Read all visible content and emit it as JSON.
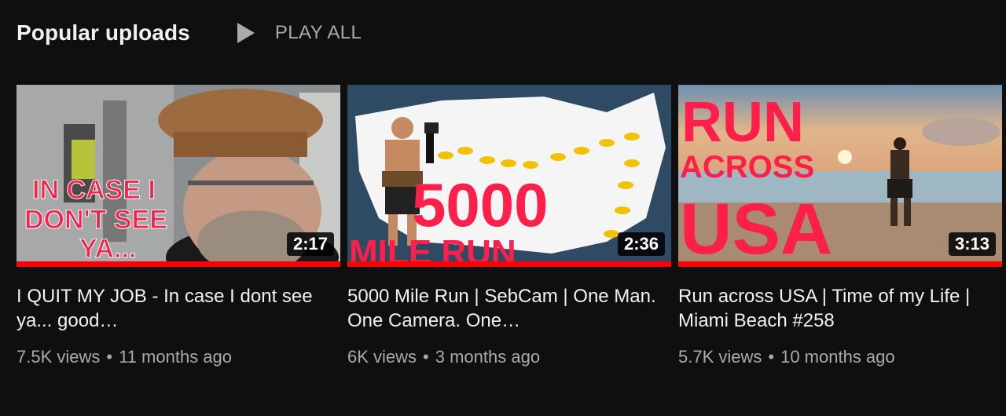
{
  "section": {
    "title": "Popular uploads",
    "play_all_label": "PLAY ALL"
  },
  "videos": [
    {
      "title": "I QUIT MY JOB - In case I dont see ya... good…",
      "duration": "2:17",
      "views": "7.5K views",
      "age": "11 months ago",
      "thumb_text": [
        "IN CASE I",
        "DON'T SEE",
        "YA..."
      ]
    },
    {
      "title": "5000 Mile Run | SebCam | One Man. One Camera. One…",
      "duration": "2:36",
      "views": "6K views",
      "age": "3 months ago",
      "thumb_text": [
        "5000",
        "MILE RUN"
      ]
    },
    {
      "title": "Run across USA | Time of my Life | Miami Beach #258",
      "duration": "3:13",
      "views": "5.7K views",
      "age": "10 months ago",
      "thumb_text": [
        "RUN",
        "ACROSS",
        "USA"
      ]
    }
  ],
  "colors": {
    "background": "#0f0f0f",
    "progress": "#ff0000",
    "thumb_text": "#ff1f4b",
    "secondary_text": "#aaaaaa"
  },
  "icons": {
    "play_all": "play-icon",
    "separator": "•"
  }
}
